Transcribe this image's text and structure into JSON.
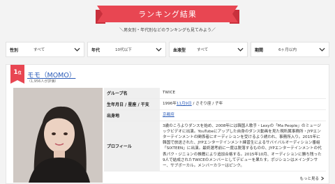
{
  "header": {
    "title": "ランキング結果",
    "subtitle": "＼男女別・年代別などのランキングも見てみよう／"
  },
  "filters": [
    {
      "label": "性別",
      "value": "すべて"
    },
    {
      "label": "年代",
      "value": "10代以下"
    },
    {
      "label": "血液型",
      "value": "すべて"
    },
    {
      "label": "期間",
      "value": "6ヶ月以内"
    }
  ],
  "result": {
    "rank_number": "1",
    "rank_suffix": "位",
    "name": "モモ（MOMO）",
    "votes": "（1,956人が評価）",
    "group_label": "グループ名",
    "group_value": "TWICE",
    "birth_label": "生年月日 / 星座 / 干支",
    "birth_year": "1996年",
    "birth_date": "11月9日",
    "birth_rest": " / さそり座 / 子年",
    "origin_label": "出身地",
    "origin_value": "京都府",
    "profile_label": "プロフィール",
    "profile_value": "3歳のころよりダンスを始め、2008年には韓国人歌手・Lexyの「Ma People」のミュージックビデオに出演。YouTubeにアップした自身のダンス動画を見た現所属事務所・JYPエンターテインメントの関係者にオーディションを受けるよう誘われ、事務所入り。2015年に韓国で放送された、JYPエンターテインメント練習生によるサバイバルオーディション番組「SIXTEEN」に出演。最終選考前に一度は脱落するものの、JYPエンターテインメントの代表パク・ジニョンの推薦により追加合格する。2015年10月、オーディションに勝ち残った9人で結成されたTWICEのメンバーとしてデビューを果たす。ポジションはメインダンサー、サブボーカル。メンバーカラーはピンク。",
    "more_label": "もっと見る"
  },
  "colors": {
    "accent": "#e84652",
    "link": "#2a5bb8"
  }
}
